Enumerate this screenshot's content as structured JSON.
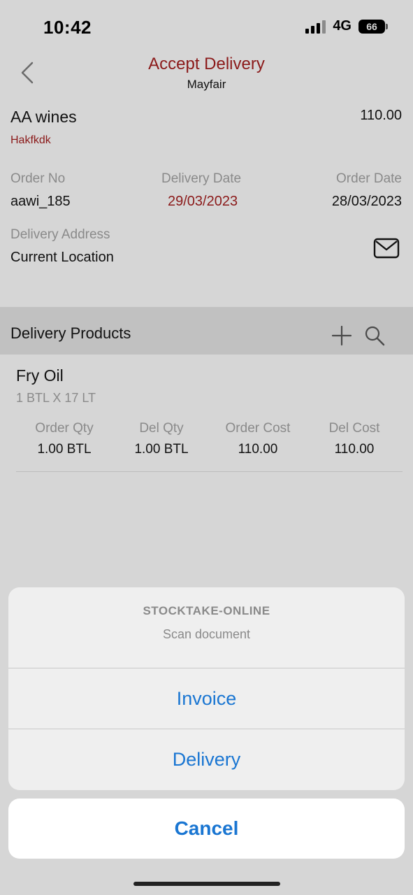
{
  "status": {
    "time": "10:42",
    "network": "4G",
    "battery": "66"
  },
  "nav": {
    "title": "Accept Delivery",
    "subtitle": "Mayfair",
    "back_icon": "chevron-left-icon"
  },
  "order": {
    "supplier": "AA wines",
    "total": "110.00",
    "code": "Hakfkdk",
    "order_no_label": "Order No",
    "order_no": "aawi_185",
    "delivery_date_label": "Delivery Date",
    "delivery_date": "29/03/2023",
    "order_date_label": "Order Date",
    "order_date": "28/03/2023",
    "address_label": "Delivery Address",
    "address": "Current Location",
    "mail_icon": "envelope-icon"
  },
  "products": {
    "title": "Delivery Products",
    "add_icon": "plus-icon",
    "search_icon": "search-icon",
    "items": [
      {
        "name": "Fry Oil",
        "pack": "1 BTL X 17 LT",
        "headers": [
          "Order Qty",
          "Del Qty",
          "Order Cost",
          "Del Cost"
        ],
        "values": [
          "1.00 BTL",
          "1.00 BTL",
          "110.00",
          "110.00"
        ]
      }
    ]
  },
  "action_sheet": {
    "title": "STOCKTAKE-ONLINE",
    "message": "Scan document",
    "options": [
      "Invoice",
      "Delivery"
    ],
    "cancel": "Cancel"
  },
  "colors": {
    "accent_red": "#8b1a1a",
    "ios_blue": "#1a76d2"
  }
}
